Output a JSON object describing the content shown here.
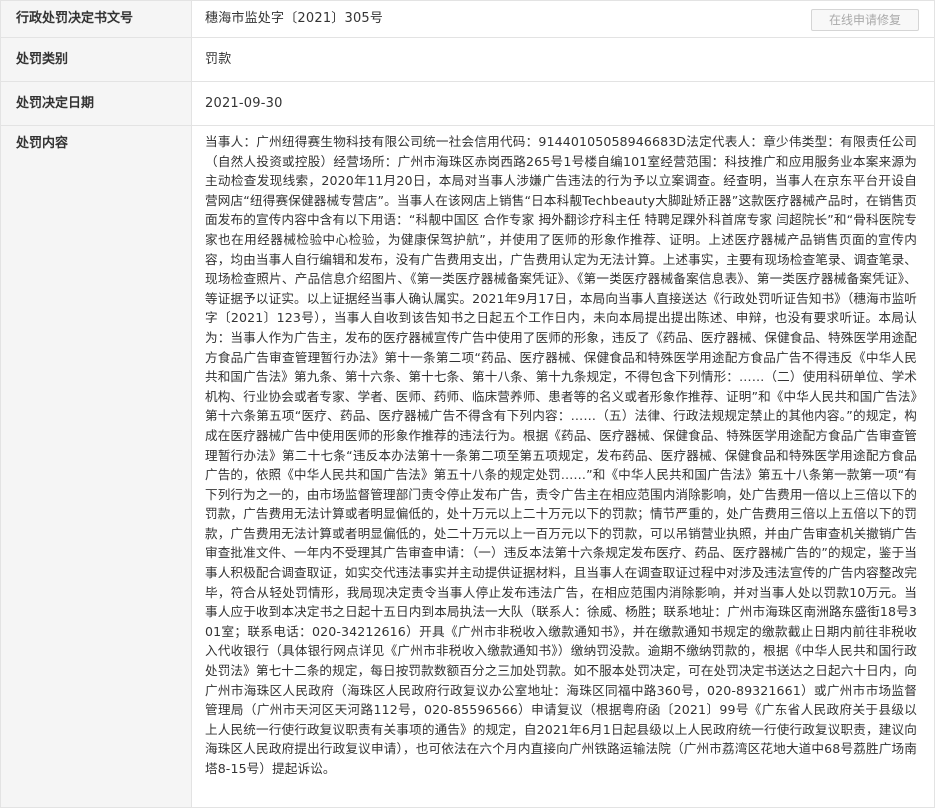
{
  "rows": {
    "doc_number": {
      "label": "行政处罚决定书文号",
      "value": "穗海市监处字〔2021〕305号",
      "button": "在线申请修复"
    },
    "category": {
      "label": "处罚类别",
      "value": "罚款"
    },
    "date": {
      "label": "处罚决定日期",
      "value": "2021-09-30"
    },
    "content": {
      "label": "处罚内容",
      "value": "当事人：广州纽得赛生物科技有限公司统一社会信用代码：91440105058946683D法定代表人：章少伟类型：有限责任公司（自然人投资或控股）经营场所：广州市海珠区赤岗西路265号1号楼自编101室经营范围：科技推广和应用服务业本案来源为主动检查发现线索，2020年11月20日，本局对当事人涉嫌广告违法的行为予以立案调查。经查明，当事人在京东平台开设自营网店“纽得赛保健器械专营店”。当事人在该网店上销售“日本科靓Techbeauty大脚趾矫正器”这款医疗器械产品时，在销售页面发布的宣传内容中含有以下用语：“科靓中国区 合作专家 拇外翻诊疗科主任 特聘足踝外科首席专家 闫超院长”和“骨科医院专家也在用经器械检验中心检验，为健康保驾护航”，并使用了医师的形象作推荐、证明。上述医疗器械产品销售页面的宣传内容，均由当事人自行编辑和发布，没有广告费用支出，广告费用认定为无法计算。上述事实，主要有现场检查笔录、调查笔录、现场检查照片、产品信息介绍图片、《第一类医疗器械备案凭证》、《第一类医疗器械备案信息表》、第一类医疗器械备案凭证》、等证据予以证实。以上证据经当事人确认属实。2021年9月17日，本局向当事人直接送达《行政处罚听证告知书》（穗海市监听字〔2021〕123号），当事人自收到该告知书之日起五个工作日内，未向本局提出提出陈述、申辩，也没有要求听证。本局认为：当事人作为广告主，发布的医疗器械宣传广告中使用了医师的形象，违反了《药品、医疗器械、保健食品、特殊医学用途配方食品广告审查管理暂行办法》第十一条第二项“药品、医疗器械、保健食品和特殊医学用途配方食品广告不得违反《中华人民共和国广告法》第九条、第十六条、第十七条、第十八条、第十九条规定，不得包含下列情形：……（二）使用科研单位、学术机构、行业协会或者专家、学者、医师、药师、临床营养师、患者等的名义或者形象作推荐、证明”和《中华人民共和国广告法》第十六条第五项“医疗、药品、医疗器械广告不得含有下列内容：……（五）法律、行政法规规定禁止的其他内容。”的规定，构成在医疗器械广告中使用医师的形象作推荐的违法行为。根据《药品、医疗器械、保健食品、特殊医学用途配方食品广告审查管理暂行办法》第二十七条“违反本办法第十一条第二项至第五项规定，发布药品、医疗器械、保健食品和特殊医学用途配方食品广告的，依照《中华人民共和国广告法》第五十八条的规定处罚……”和《中华人民共和国广告法》第五十八条第一款第一项“有下列行为之一的，由市场监督管理部门责令停止发布广告，责令广告主在相应范围内消除影响，处广告费用一倍以上三倍以下的罚款，广告费用无法计算或者明显偏低的，处十万元以上二十万元以下的罚款；情节严重的，处广告费用三倍以上五倍以下的罚款，广告费用无法计算或者明显偏低的，处二十万元以上一百万元以下的罚款，可以吊销营业执照，并由广告审查机关撤销广告审查批准文件、一年内不受理其广告审查申请：（一）违反本法第十六条规定发布医疗、药品、医疗器械广告的”的规定，鉴于当事人积极配合调查取证，如实交代违法事实并主动提供证据材料，且当事人在调查取证过程中对涉及违法宣传的广告内容整改完毕，符合从轻处罚情形，我局现决定责令当事人停止发布违法广告，在相应范围内消除影响，并对当事人处以罚款10万元。当事人应于收到本决定书之日起十五日内到本局执法一大队（联系人：徐威、杨胜；联系地址：广州市海珠区南洲路东盛街18号301室；联系电话：020-34212616）开具《广州市非税收入缴款通知书》，并在缴款通知书规定的缴款截止日期内前往非税收入代收银行（具体银行网点详见《广州市非税收入缴款通知书》）缴纳罚没款。逾期不缴纳罚款的，根据《中华人民共和国行政处罚法》第七十二条的规定，每日按罚款数额百分之三加处罚款。如不服本处罚决定，可在处罚决定书送达之日起六十日内，向广州市海珠区人民政府（海珠区人民政府行政复议办公室地址：海珠区同福中路360号，020-89321661）或广州市市场监督管理局（广州市天河区天河路112号，020-85596566）申请复议（根据粤府函〔2021〕99号《广东省人民政府关于县级以上人民统一行使行政复议职责有关事项的通告》的规定，自2021年6月1日起县级以上人民政府统一行使行政复议职责，建议向海珠区人民政府提出行政复议申请），也可依法在六个月内直接向广州铁路运输法院（广州市荔湾区花地大道中68号荔胜广场南塔8-15号）提起诉讼。"
    }
  }
}
